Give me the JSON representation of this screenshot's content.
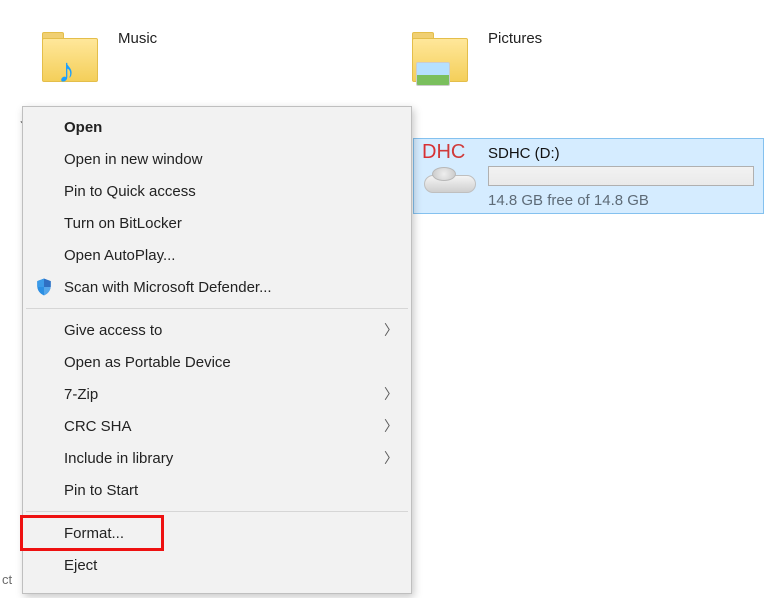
{
  "folders": {
    "music": {
      "label": "Music"
    },
    "pictures": {
      "label": "Pictures"
    }
  },
  "drive": {
    "title": "SDHC (D:)",
    "free_text": "14.8 GB free of 14.8 GB",
    "sd": "D",
    "hc": "HC"
  },
  "ctx": {
    "open": "Open",
    "open_new": "Open in new window",
    "pin_quick": "Pin to Quick access",
    "bitlocker": "Turn on BitLocker",
    "autoplay": "Open AutoPlay...",
    "scan": "Scan with Microsoft Defender...",
    "give_access": "Give access to",
    "portable": "Open as Portable Device",
    "sevenzip": "7-Zip",
    "crc": "CRC SHA",
    "include_lib": "Include in library",
    "pin_start": "Pin to Start",
    "format": "Format...",
    "eject": "Eject"
  },
  "page_fragment": "ct"
}
